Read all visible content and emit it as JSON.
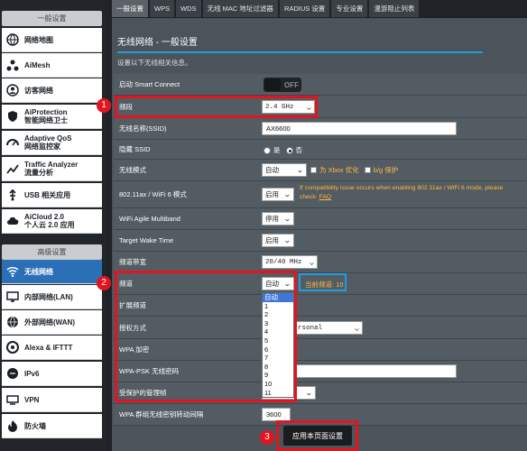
{
  "sidebar": {
    "header_general": "一般设置",
    "header_advanced": "高级设置",
    "general_items": [
      {
        "label": "网络地图",
        "icon": "network-map-icon"
      },
      {
        "label": "AiMesh",
        "icon": "aimesh-icon"
      },
      {
        "label": "访客网络",
        "icon": "guest-network-icon"
      },
      {
        "label": "AiProtection\n智能网络卫士",
        "icon": "shield-icon"
      },
      {
        "label": "Adaptive QoS\n网络监控家",
        "icon": "qos-icon"
      },
      {
        "label": "Traffic Analyzer\n流量分析",
        "icon": "traffic-analyzer-icon"
      },
      {
        "label": "USB 相关应用",
        "icon": "usb-icon"
      },
      {
        "label": "AiCloud 2.0\n个人云 2.0 应用",
        "icon": "cloud-icon"
      }
    ],
    "advanced_items": [
      {
        "label": "无线网络",
        "icon": "wifi-icon"
      },
      {
        "label": "内部网络(LAN)",
        "icon": "lan-icon"
      },
      {
        "label": "外部网络(WAN)",
        "icon": "globe-icon"
      },
      {
        "label": "Alexa & IFTTT",
        "icon": "alexa-icon"
      },
      {
        "label": "IPv6",
        "icon": "ipv6-icon"
      },
      {
        "label": "VPN",
        "icon": "vpn-icon"
      },
      {
        "label": "防火墙",
        "icon": "firewall-icon"
      }
    ]
  },
  "tabs": [
    "一般设置",
    "WPS",
    "WDS",
    "无线 MAC 地址过滤器",
    "RADIUS 设置",
    "专业设置",
    "漫游阻止列表"
  ],
  "page": {
    "title": "无线网络 - 一般设置",
    "description": "设置以下无线相关信息。"
  },
  "form": {
    "smart_connect_label": "启动 Smart Connect",
    "smart_connect_value": "OFF",
    "band_label": "频段",
    "band_value": "2.4 GHz",
    "ssid_label": "无线名称(SSID)",
    "ssid_value": "AX6600",
    "hide_ssid_label": "隐藏 SSID",
    "hide_ssid_yes": "是",
    "hide_ssid_no": "否",
    "wireless_mode_label": "无线模式",
    "wireless_mode_value": "自动",
    "xbox_label": "为 Xbox 优化",
    "bg_protect_label": "b/g 保护",
    "ax_label": "802.11ax / WiFi 6 模式",
    "ax_value": "启用",
    "ax_note": "If compatibility issue occurs when enabling 802.11ax / WiFi 6 mode, please check:",
    "ax_note_link": "FAQ",
    "agile_label": "WiFi Agile Multiband",
    "agile_value": "停用",
    "twt_label": "Target Wake Time",
    "twt_value": "启用",
    "bandwidth_label": "频道带宽",
    "bandwidth_value": "20/40 MHz",
    "channel_label": "频道",
    "channel_value": "自动",
    "current_channel": "当前频道: 10",
    "ext_channel_label": "扩展频道",
    "auth_label": "授权方式",
    "auth_value_partial": "rsonal",
    "wpa_enc_label": "WPA 加密",
    "wpa_psk_label": "WPA-PSK 无线密码",
    "pmf_label": "受保护的管理帧",
    "gtk_label": "WPA 群组无线密钥转动间隔",
    "gtk_value": "3600"
  },
  "channel_options": [
    "自动",
    "1",
    "2",
    "3",
    "4",
    "5",
    "6",
    "7",
    "8",
    "9",
    "10",
    "11"
  ],
  "channel_selected_index": 0,
  "apply_button": "应用本页面设置",
  "annotations": [
    "1",
    "2",
    "3"
  ],
  "colors": {
    "accent": "#2a9bd8",
    "annotation": "#e3141f",
    "note": "#ffb93c",
    "active_item": "#2b6fb7"
  }
}
